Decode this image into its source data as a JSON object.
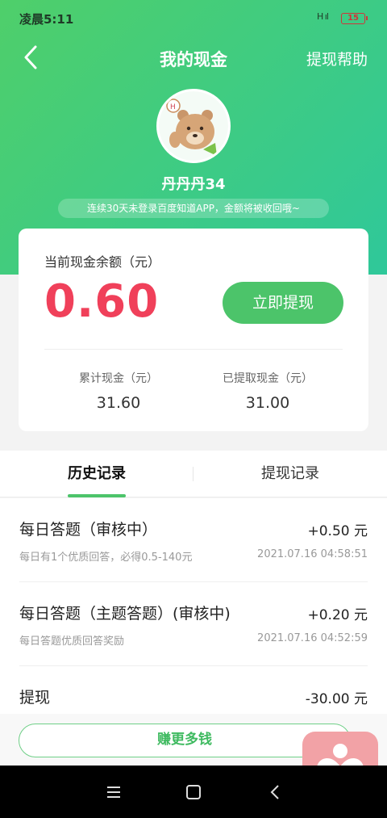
{
  "status_bar": {
    "time": "凌晨5:11",
    "signal": "H ıl",
    "battery": "15"
  },
  "nav": {
    "title": "我的现金",
    "help": "提现帮助"
  },
  "profile": {
    "username": "丹丹丹34",
    "notice": "连续30天未登录百度知道APP，金额将被收回哦~"
  },
  "balance": {
    "label": "当前现金余额（元）",
    "value": "0.60",
    "withdraw_button": "立即提现",
    "total_label": "累计现金（元）",
    "total_value": "31.60",
    "withdrawn_label": "已提取现金（元）",
    "withdrawn_value": "31.00"
  },
  "tabs": [
    {
      "label": "历史记录",
      "active": true
    },
    {
      "label": "提现记录",
      "active": false
    }
  ],
  "records": [
    {
      "title": "每日答题（审核中）",
      "amount": "+0.50 元",
      "desc": "每日有1个优质回答，必得0.5-140元",
      "time": "2021.07.16 04:58:51"
    },
    {
      "title": "每日答题（主题答题）(审核中)",
      "amount": "+0.20 元",
      "desc": "每日答题优质回答奖励",
      "time": "2021.07.16 04:52:59"
    },
    {
      "title": "提现",
      "amount": "-30.00 元",
      "desc": "",
      "time": ""
    }
  ],
  "earn_button": "赚更多钱",
  "colors": {
    "brand_green": "#4cc46a",
    "balance_red": "#f0405a",
    "badge_pink": "#f2a2a6"
  }
}
